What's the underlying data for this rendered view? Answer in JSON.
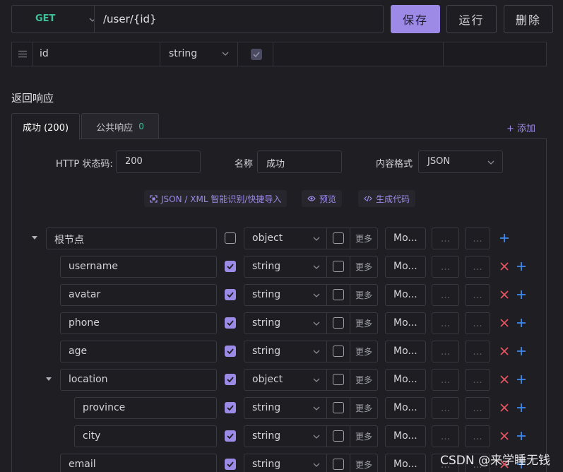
{
  "request": {
    "method": "GET",
    "url": "/user/{id}"
  },
  "actions": {
    "save": "保存",
    "run": "运行",
    "delete": "删除"
  },
  "param_row": {
    "name": "id",
    "type": "string",
    "required": true
  },
  "response": {
    "section_title": "返回响应",
    "tabs": [
      {
        "label": "成功 (200)",
        "active": true
      },
      {
        "label": "公共响应",
        "badge": "0",
        "active": false
      }
    ],
    "add_label": "+ 添加",
    "status_label": "HTTP 状态码:",
    "status_value": "200",
    "name_label": "名称",
    "name_value": "成功",
    "format_label": "内容格式",
    "format_value": "JSON",
    "tools": [
      "JSON / XML 智能识别/快捷导入",
      "预览",
      "生成代码"
    ],
    "more_label": "更多",
    "mock_placeholder": "Mo...",
    "ellipsis": "...",
    "fields": [
      {
        "name": "根节点",
        "type": "object",
        "required": false,
        "level": 0,
        "expand": true,
        "root": true
      },
      {
        "name": "username",
        "type": "string",
        "required": true,
        "level": 1
      },
      {
        "name": "avatar",
        "type": "string",
        "required": true,
        "level": 1
      },
      {
        "name": "phone",
        "type": "string",
        "required": true,
        "level": 1
      },
      {
        "name": "age",
        "type": "string",
        "required": true,
        "level": 1
      },
      {
        "name": "location",
        "type": "object",
        "required": true,
        "level": 1,
        "expand": true
      },
      {
        "name": "province",
        "type": "string",
        "required": true,
        "level": 2
      },
      {
        "name": "city",
        "type": "string",
        "required": true,
        "level": 2
      },
      {
        "name": "email",
        "type": "string",
        "required": true,
        "level": 1
      }
    ]
  },
  "watermark": "CSDN @来学睡无钱",
  "colors": {
    "accent": "#9d8ae6",
    "method_get": "#3fc19a",
    "add_blue": "#3d8bf0",
    "remove_red": "#e25561"
  }
}
